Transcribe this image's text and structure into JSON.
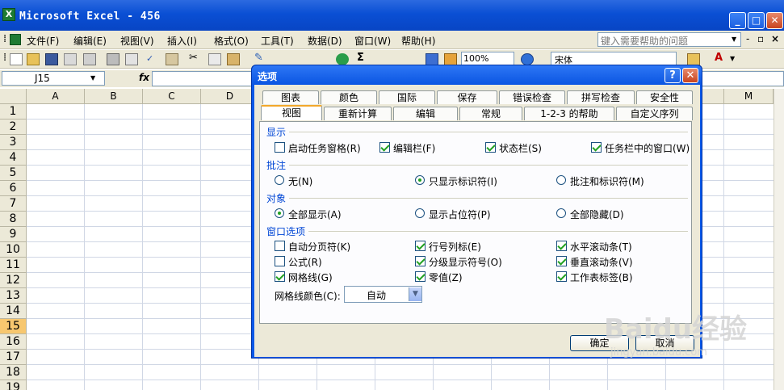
{
  "window": {
    "title": "Microsoft Excel - 456",
    "logo": "X",
    "minimize": "_",
    "maximize": "□",
    "close": "✕"
  },
  "menubar": {
    "items": [
      "文件(F)",
      "编辑(E)",
      "视图(V)",
      "插入(I)",
      "格式(O)",
      "工具(T)",
      "数据(D)",
      "窗口(W)",
      "帮助(H)"
    ],
    "help_placeholder": "键入需要帮助的问题"
  },
  "toolbar": {
    "zoom": "100%",
    "font": "宋体",
    "sum_icon": "Σ",
    "font_color_letter": "A"
  },
  "formula_bar": {
    "name_box": "J15",
    "fx": "fx",
    "formula": ""
  },
  "grid": {
    "columns": [
      "A",
      "B",
      "C",
      "D",
      "",
      "",
      "",
      "",
      "",
      "",
      "",
      "",
      "M"
    ],
    "rows": [
      "1",
      "2",
      "3",
      "4",
      "5",
      "6",
      "7",
      "8",
      "9",
      "10",
      "11",
      "12",
      "13",
      "14",
      "15",
      "16",
      "17",
      "18",
      "19"
    ],
    "selected_row": "15"
  },
  "dialog": {
    "title": "选项",
    "help": "?",
    "close": "✕",
    "tabs_row1": [
      "图表",
      "颜色",
      "国际",
      "保存",
      "错误检查",
      "拼写检查",
      "安全性"
    ],
    "tabs_row2": [
      "视图",
      "重新计算",
      "编辑",
      "常规",
      "1-2-3 的帮助",
      "自定义序列"
    ],
    "active_tab": "视图",
    "groups": {
      "display": {
        "label": "显示",
        "options": [
          {
            "label": "启动任务窗格(R)",
            "checked": false
          },
          {
            "label": "编辑栏(F)",
            "checked": true
          },
          {
            "label": "状态栏(S)",
            "checked": true
          },
          {
            "label": "任务栏中的窗口(W)",
            "checked": true
          }
        ]
      },
      "comments": {
        "label": "批注",
        "options": [
          {
            "label": "无(N)",
            "selected": false
          },
          {
            "label": "只显示标识符(I)",
            "selected": true
          },
          {
            "label": "批注和标识符(M)",
            "selected": false
          }
        ]
      },
      "objects": {
        "label": "对象",
        "options": [
          {
            "label": "全部显示(A)",
            "selected": true
          },
          {
            "label": "显示占位符(P)",
            "selected": false
          },
          {
            "label": "全部隐藏(D)",
            "selected": false
          }
        ]
      },
      "window_options": {
        "label": "窗口选项",
        "options": [
          {
            "label": "自动分页符(K)",
            "checked": false
          },
          {
            "label": "行号列标(E)",
            "checked": true
          },
          {
            "label": "水平滚动条(T)",
            "checked": true
          },
          {
            "label": "公式(R)",
            "checked": false
          },
          {
            "label": "分级显示符号(O)",
            "checked": true
          },
          {
            "label": "垂直滚动条(V)",
            "checked": true
          },
          {
            "label": "网格线(G)",
            "checked": true
          },
          {
            "label": "零值(Z)",
            "checked": true
          },
          {
            "label": "工作表标签(B)",
            "checked": true
          }
        ]
      }
    },
    "gridline_color": {
      "label": "网格线颜色(C):",
      "value": "自动"
    },
    "ok": "确定",
    "cancel": "取消"
  },
  "watermark": {
    "text": "Baidu经验",
    "url": "jingyan.baidu.com"
  },
  "colors": {
    "xp_blue": "#0a55e2",
    "dialog_face": "#ece9d8",
    "check_green": "#21a121",
    "tab_highlight": "#f3a82b"
  }
}
